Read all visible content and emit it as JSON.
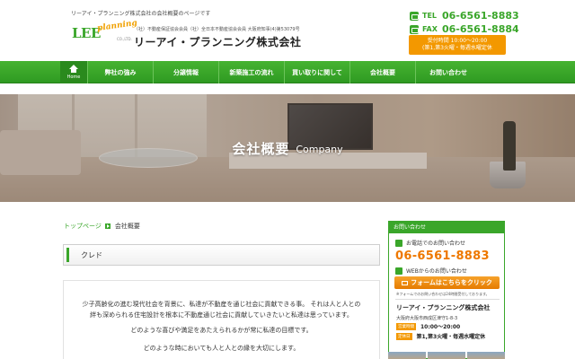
{
  "header": {
    "tagline": "リーアイ・プランニング株式会社の会社概要のページです",
    "logo_text": "LEE",
    "logo_script": "planning",
    "logo_co": "CO.,LTD.",
    "associations": "（社）不動産保証協会会員（社）全日本不動産協会会員 大阪府知事(4)第53079号",
    "company_name": "リーアイ・プランニング株式会社",
    "tel_label": "TEL",
    "tel_number": "06-6561-8883",
    "fax_label": "FAX",
    "fax_number": "06-6561-8884",
    "hours_line1": "受付時間 10:00～20:00",
    "hours_line2": "(第1,第3火曜・毎週水曜定休"
  },
  "nav": {
    "home_label": "Home",
    "items": [
      {
        "label": "弊社の強み"
      },
      {
        "label": "分譲情報"
      },
      {
        "label": "新築施工の流れ"
      },
      {
        "label": "買い取りに関して"
      },
      {
        "label": "会社概要"
      },
      {
        "label": "お問い合わせ"
      }
    ]
  },
  "hero": {
    "title_jp": "会社概要",
    "title_en": "Company"
  },
  "breadcrumb": {
    "home": "トップページ",
    "current": "会社概要"
  },
  "section": {
    "heading": "クレド",
    "paragraph1_line1": "少子高齢化の進む現代社会を背景に、私達が不動産を通じ社会に貢献できる事。 それは人と人との",
    "paragraph1_line2": "絆も深められる住宅設計を根本に不動産通じ社会に貢献していきたいと私達は思っています。",
    "paragraph2": "どのような喜びや満足をあたえられるかが常に私達の目標です。",
    "paragraph3": "どのような時においても人と人との縁を大切にします。"
  },
  "sidebar": {
    "head": "お問い合わせ",
    "phone_caption": "お電話でのお問い合わせ",
    "phone_number": "06-6561-8883",
    "web_caption": "WEBからのお問い合わせ",
    "form_button": "フォームはこちらをクリック",
    "form_note": "※フォームでのお問い合わせは24時間受付しております。",
    "company": "リーアイ・プランニング株式会社",
    "address": "大阪府大阪市西成区津守1-8-3",
    "hours_tag": "営業時間",
    "hours_value": "10:00～20:00",
    "closed_tag": "定休日",
    "closed_value": "第1,第3火曜・毎週水曜定休"
  },
  "colors": {
    "brand_green": "#3aa62a",
    "accent_orange": "#f39800"
  }
}
